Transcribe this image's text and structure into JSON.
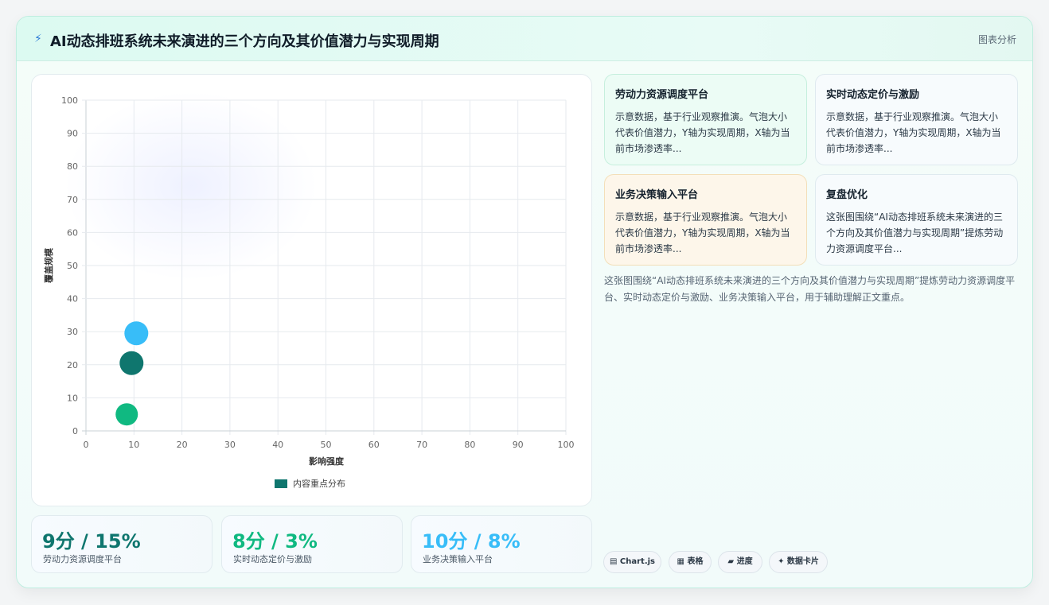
{
  "header": {
    "icon": "lightning-icon",
    "title": "AI动态排班系统未来演进的三个方向及其价值潜力与实现周期",
    "tag": "图表分析"
  },
  "chart_data": {
    "type": "scatter",
    "title": "",
    "xlabel": "影响强度",
    "ylabel": "覆盖规模",
    "xlim": [
      0,
      100
    ],
    "ylim": [
      0,
      100
    ],
    "xticks": [
      "0",
      "10",
      "20",
      "30",
      "40",
      "50",
      "60",
      "70",
      "80",
      "90",
      "100"
    ],
    "yticks": [
      "0",
      "10",
      "20",
      "30",
      "40",
      "50",
      "60",
      "70",
      "80",
      "90",
      "100"
    ],
    "grid": true,
    "legend_position": "bottom",
    "series": [
      {
        "name": "内容重点分布",
        "legend_color": "#0f766e",
        "points": [
          {
            "x": 10.5,
            "y": 29.5,
            "r": 15,
            "color": "#38bdf8"
          },
          {
            "x": 9.5,
            "y": 20.5,
            "r": 15,
            "color": "#0f766e"
          },
          {
            "x": 8.5,
            "y": 5,
            "r": 14,
            "color": "#10b981"
          }
        ]
      }
    ]
  },
  "kpis": [
    {
      "value": "9分 / 15%",
      "label": "劳动力资源调度平台",
      "color": "#0f766e"
    },
    {
      "value": "8分 / 3%",
      "label": "实时动态定价与激励",
      "color": "#10b981"
    },
    {
      "value": "10分 / 8%",
      "label": "业务决策输入平台",
      "color": "#38bdf8"
    }
  ],
  "cards": [
    {
      "title": "劳动力资源调度平台",
      "body": "示意数据，基于行业观察推演。气泡大小代表价值潜力，Y轴为实现周期，X轴为当前市场渗透率..."
    },
    {
      "title": "实时动态定价与激励",
      "body": "示意数据，基于行业观察推演。气泡大小代表价值潜力，Y轴为实现周期，X轴为当前市场渗透率..."
    },
    {
      "title": "业务决策输入平台",
      "body": "示意数据，基于行业观察推演。气泡大小代表价值潜力，Y轴为实现周期，X轴为当前市场渗透率..."
    },
    {
      "title": "复盘优化",
      "body": "这张图围绕“AI动态排班系统未来演进的三个方向及其价值潜力与实现周期”提炼劳动力资源调度平台..."
    }
  ],
  "summary": "这张图围绕“AI动态排班系统未来演进的三个方向及其价值潜力与实现周期”提炼劳动力资源调度平台、实时动态定价与激励、业务决策输入平台，用于辅助理解正文重点。",
  "chips": [
    {
      "label": "▤ Chart.js"
    },
    {
      "label": "▦ 表格"
    },
    {
      "label": "▰ 进度"
    },
    {
      "label": "✦ 数据卡片"
    }
  ]
}
